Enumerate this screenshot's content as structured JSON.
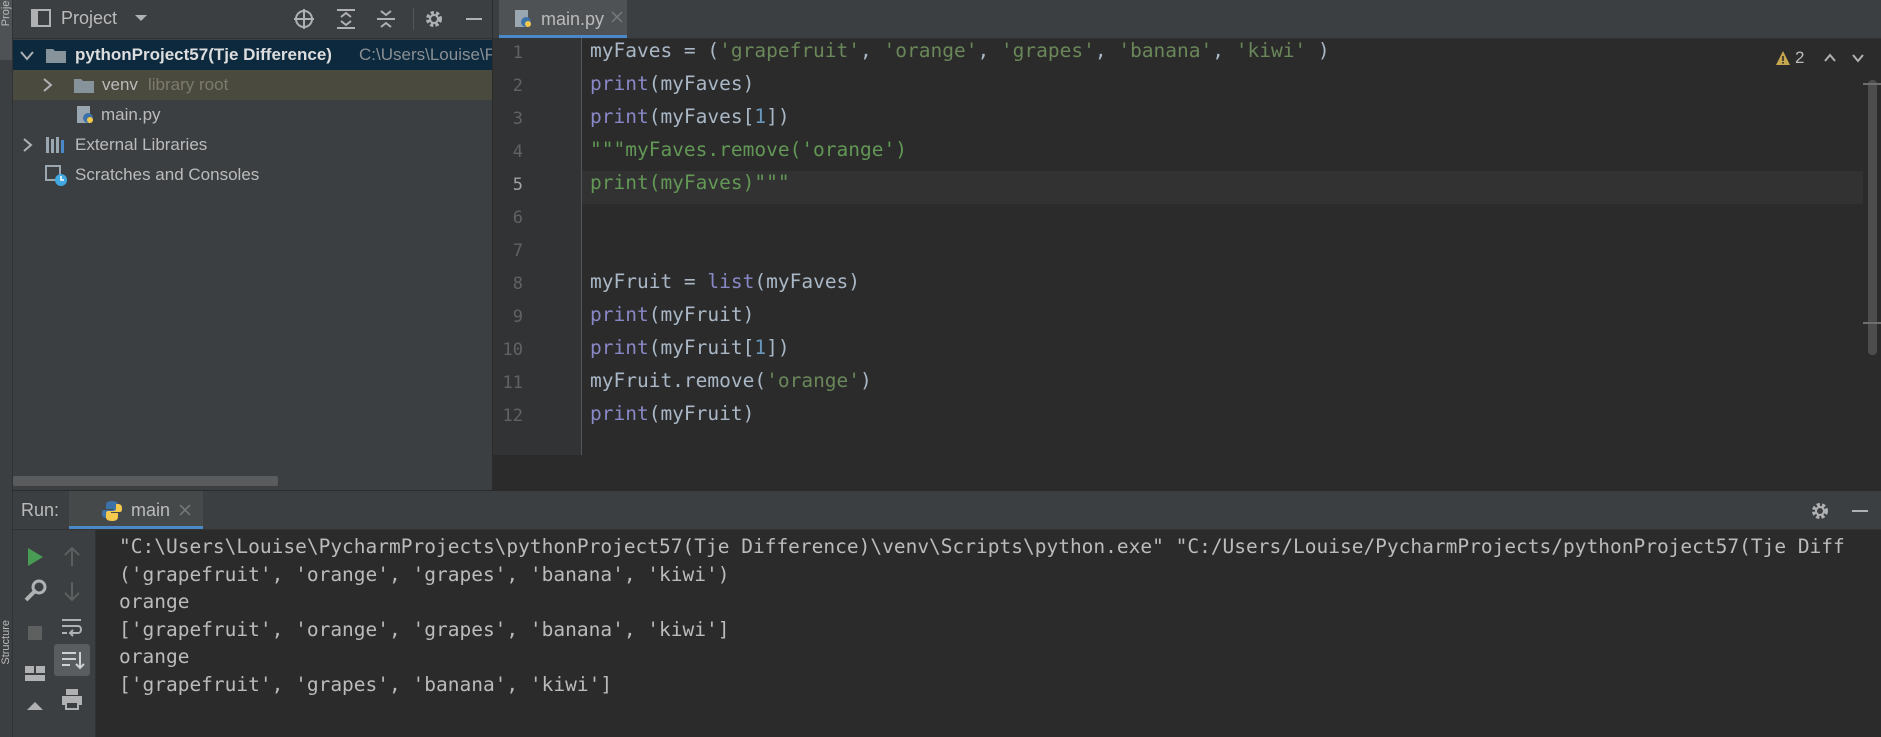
{
  "project_panel": {
    "header": {
      "title": "Project"
    },
    "tree": [
      {
        "name": "pythonProject57(Tje Difference)",
        "hint": "C:\\Users\\Louise\\Pych"
      },
      {
        "name": "venv",
        "hint": "library root"
      },
      {
        "name": "main.py"
      },
      {
        "name": "External Libraries"
      },
      {
        "name": "Scratches and Consoles"
      }
    ]
  },
  "tool_stripe": {
    "top_label": "Project",
    "bottom_label": "Structure"
  },
  "editor": {
    "tab": {
      "label": "main.py"
    },
    "warnings": {
      "count": "2"
    },
    "line_numbers": [
      "1",
      "2",
      "3",
      "4",
      "5",
      "6",
      "7",
      "8",
      "9",
      "10",
      "11",
      "12"
    ],
    "current_line": "5",
    "lines": [
      [
        {
          "t": "myFaves = (",
          "c": "p"
        },
        {
          "t": "'grapefruit'",
          "c": "s"
        },
        {
          "t": ", ",
          "c": "p"
        },
        {
          "t": "'orange'",
          "c": "s"
        },
        {
          "t": ", ",
          "c": "p"
        },
        {
          "t": "'grapes'",
          "c": "s"
        },
        {
          "t": ", ",
          "c": "p"
        },
        {
          "t": "'banana'",
          "c": "s"
        },
        {
          "t": ", ",
          "c": "p"
        },
        {
          "t": "'kiwi'",
          "c": "s"
        },
        {
          "t": " )",
          "c": "p"
        }
      ],
      [
        {
          "t": "print",
          "c": "k"
        },
        {
          "t": "(myFaves)",
          "c": "p"
        }
      ],
      [
        {
          "t": "print",
          "c": "k"
        },
        {
          "t": "(myFaves[",
          "c": "p"
        },
        {
          "t": "1",
          "c": "n"
        },
        {
          "t": "])",
          "c": "p"
        }
      ],
      [
        {
          "t": "\"\"\"myFaves.remove('orange')",
          "c": "d"
        }
      ],
      [
        {
          "t": "print(myFaves)\"\"\"",
          "c": "d"
        }
      ],
      [],
      [],
      [
        {
          "t": "myFruit = ",
          "c": "p"
        },
        {
          "t": "list",
          "c": "k"
        },
        {
          "t": "(myFaves)",
          "c": "p"
        }
      ],
      [
        {
          "t": "print",
          "c": "k"
        },
        {
          "t": "(myFruit)",
          "c": "p"
        }
      ],
      [
        {
          "t": "print",
          "c": "k"
        },
        {
          "t": "(myFruit[",
          "c": "p"
        },
        {
          "t": "1",
          "c": "n"
        },
        {
          "t": "])",
          "c": "p"
        }
      ],
      [
        {
          "t": "myFruit.remove(",
          "c": "p"
        },
        {
          "t": "'orange'",
          "c": "s"
        },
        {
          "t": ")",
          "c": "p"
        }
      ],
      [
        {
          "t": "print",
          "c": "k"
        },
        {
          "t": "(myFruit)",
          "c": "p"
        }
      ]
    ]
  },
  "run_panel": {
    "label": "Run:",
    "tab": {
      "label": "main"
    },
    "console": [
      "\"C:\\Users\\Louise\\PycharmProjects\\pythonProject57(Tje Difference)\\venv\\Scripts\\python.exe\" \"C:/Users/Louise/PycharmProjects/pythonProject57(Tje Diff",
      "('grapefruit', 'orange', 'grapes', 'banana', 'kiwi')",
      "orange",
      "['grapefruit', 'orange', 'grapes', 'banana', 'kiwi']",
      "orange",
      "['grapefruit', 'grapes', 'banana', 'kiwi']"
    ]
  },
  "colors": {
    "keyword": "#8888c6",
    "string": "#6a8759",
    "number": "#6897bb",
    "docstring": "#629755",
    "plain": "#a9b7c6",
    "accent": "#4a88c7"
  }
}
